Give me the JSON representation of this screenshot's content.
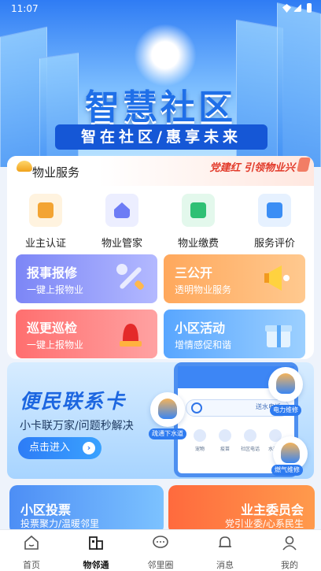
{
  "status_bar": {
    "time": "11:07"
  },
  "hero": {
    "title": "智慧社区",
    "subtitle": "智在社区/惠享未来"
  },
  "property": {
    "title": "物业服务",
    "slogan": "党建红 引领物业兴",
    "services": [
      {
        "label": "业主认证",
        "icon": "owner-id-icon",
        "color": "#f3a433"
      },
      {
        "label": "物业管家",
        "icon": "house-keeper-icon",
        "color": "#6d7cf5"
      },
      {
        "label": "物业缴费",
        "icon": "wallet-icon",
        "color": "#2fc074"
      },
      {
        "label": "服务评价",
        "icon": "evaluation-icon",
        "color": "#3b8ef5"
      }
    ],
    "tiles": [
      {
        "title": "报事报修",
        "sub": "一键上报物业",
        "icon": "wrench-icon",
        "colors": [
          "#7c86f6",
          "#b3b9ff"
        ]
      },
      {
        "title": "三公开",
        "sub": "透明物业服务",
        "icon": "megaphone-icon",
        "colors": [
          "#ffa85c",
          "#ffc98f"
        ]
      },
      {
        "title": "巡更巡检",
        "sub": "一键上报物业",
        "icon": "alarm-light-icon",
        "colors": [
          "#ff6f6f",
          "#ffa2a2"
        ]
      },
      {
        "title": "小区活动",
        "sub": "增情感促和谐",
        "icon": "gift-icon",
        "colors": [
          "#58a6ff",
          "#9cd0ff"
        ]
      }
    ]
  },
  "banner": {
    "title": "便民联系卡",
    "subtitle": "小卡联万家/问题秒解决",
    "button": "点击进入",
    "search_label": "送水电话",
    "shortcuts": [
      "宠物",
      "疫苗",
      "社区电话",
      "水开锁"
    ],
    "bubbles": [
      "电力维修",
      "疏通下水道",
      "燃气维修"
    ]
  },
  "vote": {
    "title": "小区投票",
    "sub": "投票聚力/温暖邻里"
  },
  "owner_committee": {
    "title": "业主委员会",
    "sub": "党引业委/心系民生"
  },
  "tabs": [
    {
      "label": "首页",
      "icon": "home-icon",
      "active": false
    },
    {
      "label": "物邻通",
      "icon": "buildings-icon",
      "active": true
    },
    {
      "label": "邻里圈",
      "icon": "chat-icon",
      "active": false
    },
    {
      "label": "消息",
      "icon": "bell-icon",
      "active": false
    },
    {
      "label": "我的",
      "icon": "user-icon",
      "active": false
    }
  ]
}
